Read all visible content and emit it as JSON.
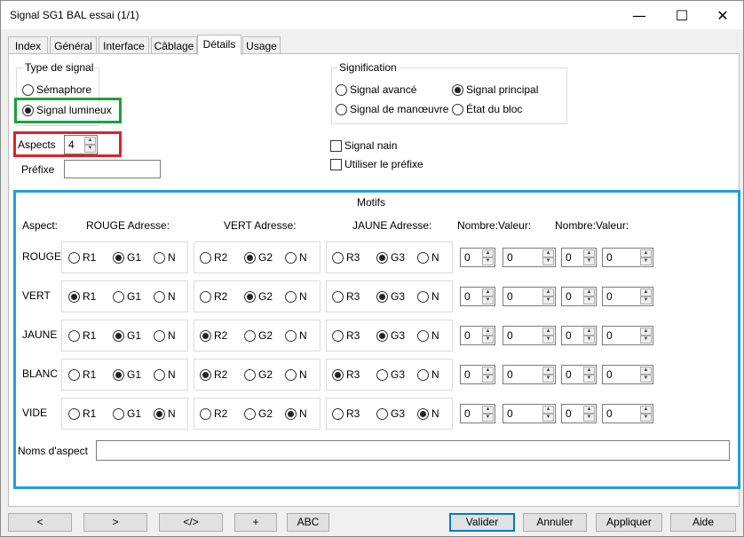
{
  "window": {
    "title": "Signal SG1 BAL essai (1/1)",
    "minimize": "—",
    "maximize": "☐",
    "close": "✕"
  },
  "tabs": [
    "Index",
    "Général",
    "Interface",
    "Câblage",
    "Détails",
    "Usage"
  ],
  "active_tab": "Détails",
  "type_signal": {
    "label": "Type de signal",
    "semaphore": "Sémaphore",
    "lumineux": "Signal lumineux",
    "selected": "Signal lumineux"
  },
  "aspects": {
    "label": "Aspects",
    "value": "4"
  },
  "prefixe": {
    "label": "Préfixe",
    "value": ""
  },
  "signification": {
    "label": "Signification",
    "options": [
      "Signal avancé",
      "Signal principal",
      "Signal de manœuvre",
      "État du bloc"
    ],
    "selected": "Signal principal"
  },
  "checks": {
    "nain": "Signal nain",
    "prefixe": "Utiliser le préfixe"
  },
  "motifs": {
    "title": "Motifs",
    "headers": {
      "aspect": "Aspect:",
      "rouge": "ROUGE Adresse:",
      "vert": "VERT Adresse:",
      "jaune": "JAUNE Adresse:",
      "nv1": "Nombre:Valeur:",
      "nv2": "Nombre:Valeur:"
    },
    "rows": [
      {
        "name": "ROUGE",
        "rouge": [
          "R1",
          "G1",
          "N"
        ],
        "rouge_sel": 1,
        "vert": [
          "R2",
          "G2",
          "N"
        ],
        "vert_sel": 1,
        "jaune": [
          "R3",
          "G3",
          "N"
        ],
        "jaune_sel": 1,
        "values": [
          "0",
          "0",
          "0",
          "0"
        ]
      },
      {
        "name": "VERT",
        "rouge": [
          "R1",
          "G1",
          "N"
        ],
        "rouge_sel": 0,
        "vert": [
          "R2",
          "G2",
          "N"
        ],
        "vert_sel": 1,
        "jaune": [
          "R3",
          "G3",
          "N"
        ],
        "jaune_sel": 1,
        "values": [
          "0",
          "0",
          "0",
          "0"
        ]
      },
      {
        "name": "JAUNE",
        "rouge": [
          "R1",
          "G1",
          "N"
        ],
        "rouge_sel": 1,
        "vert": [
          "R2",
          "G2",
          "N"
        ],
        "vert_sel": 0,
        "jaune": [
          "R3",
          "G3",
          "N"
        ],
        "jaune_sel": 1,
        "values": [
          "0",
          "0",
          "0",
          "0"
        ]
      },
      {
        "name": "BLANC",
        "rouge": [
          "R1",
          "G1",
          "N"
        ],
        "rouge_sel": 1,
        "vert": [
          "R2",
          "G2",
          "N"
        ],
        "vert_sel": 0,
        "jaune": [
          "R3",
          "G3",
          "N"
        ],
        "jaune_sel": 0,
        "values": [
          "0",
          "0",
          "0",
          "0"
        ]
      },
      {
        "name": "VIDE",
        "rouge": [
          "R1",
          "G1",
          "N"
        ],
        "rouge_sel": 2,
        "vert": [
          "R2",
          "G2",
          "N"
        ],
        "vert_sel": 2,
        "jaune": [
          "R3",
          "G3",
          "N"
        ],
        "jaune_sel": 2,
        "values": [
          "0",
          "0",
          "0",
          "0"
        ]
      }
    ],
    "noms_label": "Noms d'aspect",
    "noms_value": ""
  },
  "buttons": {
    "prev": "<",
    "next": ">",
    "code": "</>",
    "plus": "+",
    "abc": "ABC",
    "valider": "Valider",
    "annuler": "Annuler",
    "appliquer": "Appliquer",
    "aide": "Aide"
  },
  "colors": {
    "highlight_green": "#1aa33a",
    "highlight_red": "#e0202a",
    "highlight_blue": "#1ea0e6"
  }
}
